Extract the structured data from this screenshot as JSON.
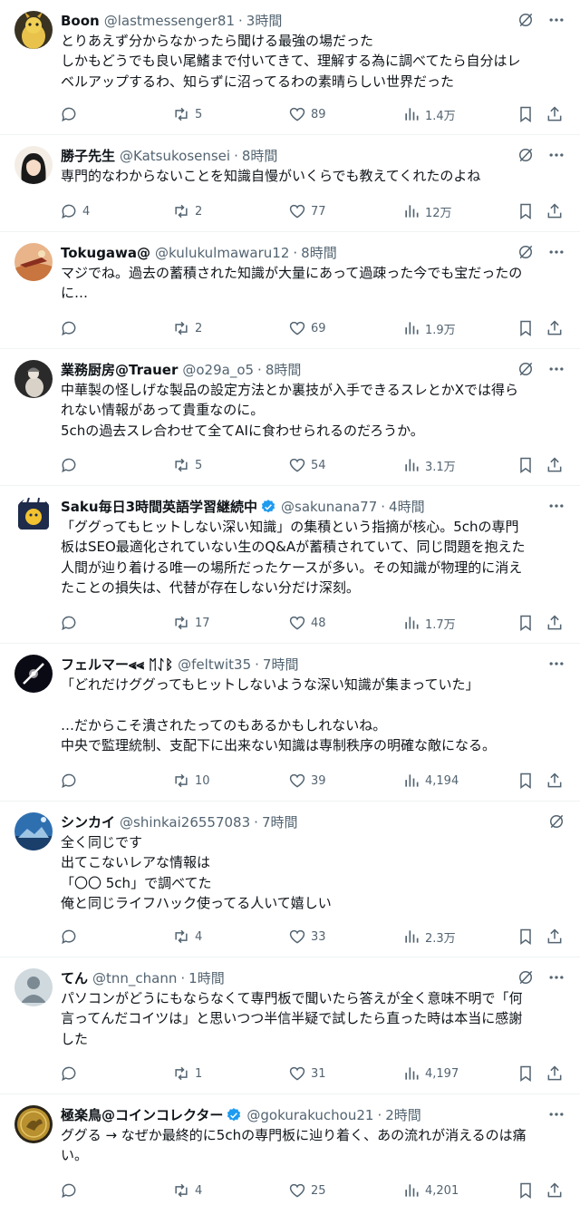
{
  "icons": {
    "reply": "reply-icon",
    "retweet": "retweet-icon",
    "like": "heart-icon",
    "views": "views-chart-icon",
    "bookmark": "bookmark-icon",
    "share": "share-icon",
    "grok": "grok-icon",
    "more": "more-dots-icon",
    "verified": "verified-badge-icon"
  },
  "colors": {
    "text": "#0f1419",
    "secondary": "#536471",
    "verified": "#1d9bf0",
    "divider": "#eff3f4"
  },
  "posts": [
    {
      "name": "Boon",
      "handle": "@lastmessenger81",
      "time": "3時間",
      "verified": false,
      "lines": [
        "とりあえず分からなかったら聞ける最強の場だった",
        "しかもどうでも良い尾鰭まで付いてきて、理解する為に調べてたら自分はレ",
        "ベルアップするわ、知らずに沼ってるわの素晴らしい世界だった"
      ],
      "replies": "",
      "reposts": "5",
      "likes": "89",
      "views": "1.4万"
    },
    {
      "name": "勝子先生",
      "handle": "@Katsukosensei",
      "time": "8時間",
      "verified": false,
      "lines": [
        "専門的なわからないことを知識自慢がいくらでも教えてくれたのよね"
      ],
      "replies": "4",
      "reposts": "2",
      "likes": "77",
      "views": "12万"
    },
    {
      "name": "Tokugawa@",
      "handle": "@kulukulmawaru12",
      "time": "8時間",
      "verified": false,
      "lines": [
        "マジでね。過去の蓄積された知識が大量にあって過疎った今でも宝だったの",
        "に…"
      ],
      "replies": "",
      "reposts": "2",
      "likes": "69",
      "views": "1.9万"
    },
    {
      "name": "業務厨房@Trauer",
      "handle": "@o29a_o5",
      "time": "8時間",
      "verified": false,
      "lines": [
        "中華製の怪しげな製品の設定方法とか裏技が入手できるスレとかXでは得ら",
        "れない情報があって貴重なのに。",
        "5chの過去スレ合わせて全てAIに食わせられるのだろうか。"
      ],
      "replies": "",
      "reposts": "5",
      "likes": "54",
      "views": "3.1万"
    },
    {
      "name": "Saku毎日3時間英語学習継続中",
      "handle": "@sakunana77",
      "time": "4時間",
      "verified": true,
      "lines": [
        "「ググってもヒットしない深い知識」の集積という指摘が核心。5chの専門",
        "板はSEO最適化されていない生のQ&Aが蓄積されていて、同じ問題を抱えた",
        "人間が辿り着ける唯一の場所だったケースが多い。その知識が物理的に消え",
        "たことの損失は、代替が存在しない分だけ深刻。"
      ],
      "replies": "",
      "reposts": "17",
      "likes": "48",
      "views": "1.7万"
    },
    {
      "name": "フェルマー⪡⪡ ᛖᛇᛒ",
      "handle": "@feltwit35",
      "time": "7時間",
      "verified": false,
      "lines": [
        "「どれだけググってもヒットしないような深い知識が集まっていた」",
        "",
        "…だからこそ潰されたってのもあるかもしれないね。",
        "中央で監理統制、支配下に出来ない知識は専制秩序の明確な敵になる。"
      ],
      "replies": "",
      "reposts": "10",
      "likes": "39",
      "views": "4,194"
    },
    {
      "name": "シンカイ",
      "handle": "@shinkai26557083",
      "time": "7時間",
      "verified": false,
      "lines": [
        "全く同じです",
        "出てこないレアな情報は",
        "「〇〇 5ch」で調べてた",
        "俺と同じライフハック使ってる人いて嬉しい"
      ],
      "replies": "",
      "reposts": "4",
      "likes": "33",
      "views": "2.3万"
    },
    {
      "name": "てん",
      "handle": "@tnn_chann",
      "time": "1時間",
      "verified": false,
      "lines": [
        "パソコンがどうにもならなくて専門板で聞いたら答えが全く意味不明で「何",
        "言ってんだコイツは」と思いつつ半信半疑で試したら直った時は本当に感謝",
        "した"
      ],
      "replies": "",
      "reposts": "1",
      "likes": "31",
      "views": "4,197"
    },
    {
      "name": "極楽鳥@コインコレクター",
      "handle": "@gokurakuchou21",
      "time": "2時間",
      "verified": true,
      "lines": [
        "ググる → なぜか最終的に5chの専門板に辿り着く、あの流れが消えるのは痛",
        "い。"
      ],
      "replies": "",
      "reposts": "4",
      "likes": "25",
      "views": "4,201"
    }
  ]
}
